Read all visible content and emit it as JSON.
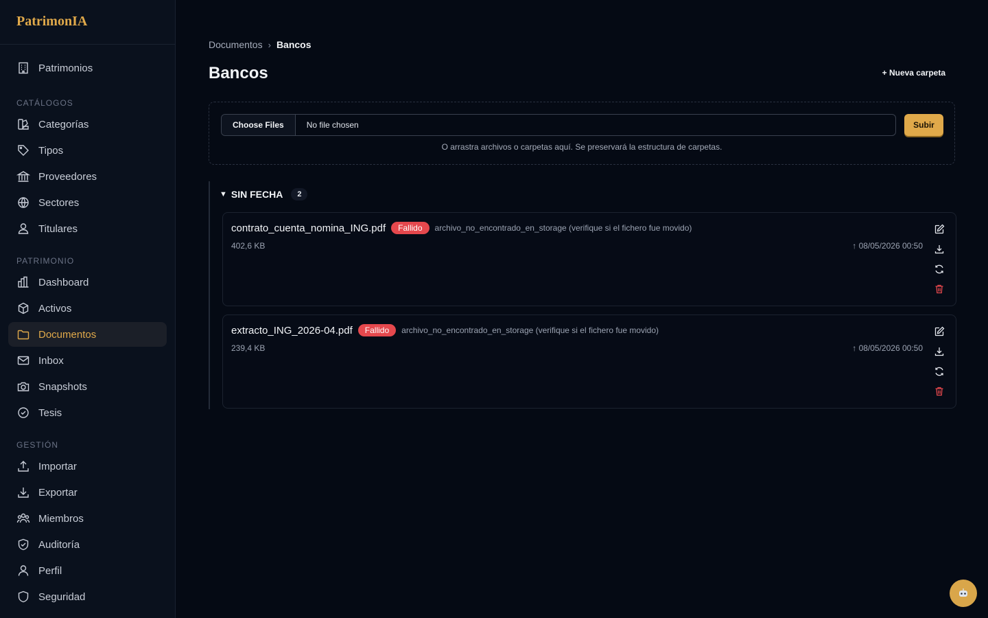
{
  "brand": "PatrimonIA",
  "nav": {
    "top": [
      {
        "label": "Patrimonios"
      }
    ],
    "sections": [
      {
        "title": "CATÁLOGOS",
        "items": [
          {
            "label": "Categorías"
          },
          {
            "label": "Tipos"
          },
          {
            "label": "Proveedores"
          },
          {
            "label": "Sectores"
          },
          {
            "label": "Titulares"
          }
        ]
      },
      {
        "title": "PATRIMONIO",
        "items": [
          {
            "label": "Dashboard"
          },
          {
            "label": "Activos"
          },
          {
            "label": "Documentos"
          },
          {
            "label": "Inbox"
          },
          {
            "label": "Snapshots"
          },
          {
            "label": "Tesis"
          }
        ]
      },
      {
        "title": "GESTIÓN",
        "items": [
          {
            "label": "Importar"
          },
          {
            "label": "Exportar"
          },
          {
            "label": "Miembros"
          },
          {
            "label": "Auditoría"
          },
          {
            "label": "Perfil"
          },
          {
            "label": "Seguridad"
          }
        ]
      }
    ]
  },
  "breadcrumb": {
    "parent": "Documentos",
    "separator": "›",
    "current": "Bancos"
  },
  "page": {
    "title": "Bancos",
    "new_folder": "+ Nueva carpeta"
  },
  "upload": {
    "choose_label": "Choose Files",
    "no_file": "No file chosen",
    "submit": "Subir",
    "hint": "O arrastra archivos o carpetas aquí. Se preservará la estructura de carpetas."
  },
  "group": {
    "caret": "▼",
    "title": "SIN FECHA",
    "count": "2"
  },
  "documents": [
    {
      "name": "contrato_cuenta_nomina_ING.pdf",
      "status": "Fallido",
      "error": "archivo_no_encontrado_en_storage (verifique si el fichero fue movido)",
      "size": "402,6 KB",
      "uploaded": "↑ 08/05/2026 00:50"
    },
    {
      "name": "extracto_ING_2026-04.pdf",
      "status": "Fallido",
      "error": "archivo_no_encontrado_en_storage (verifique si el fichero fue movido)",
      "size": "239,4 KB",
      "uploaded": "↑ 08/05/2026 00:50"
    }
  ],
  "colors": {
    "accent": "#e0a94a",
    "danger": "#e5484d",
    "background": "#050a14",
    "sidebar": "#0a111d"
  },
  "icons": {
    "fab": "assistant-icon"
  }
}
